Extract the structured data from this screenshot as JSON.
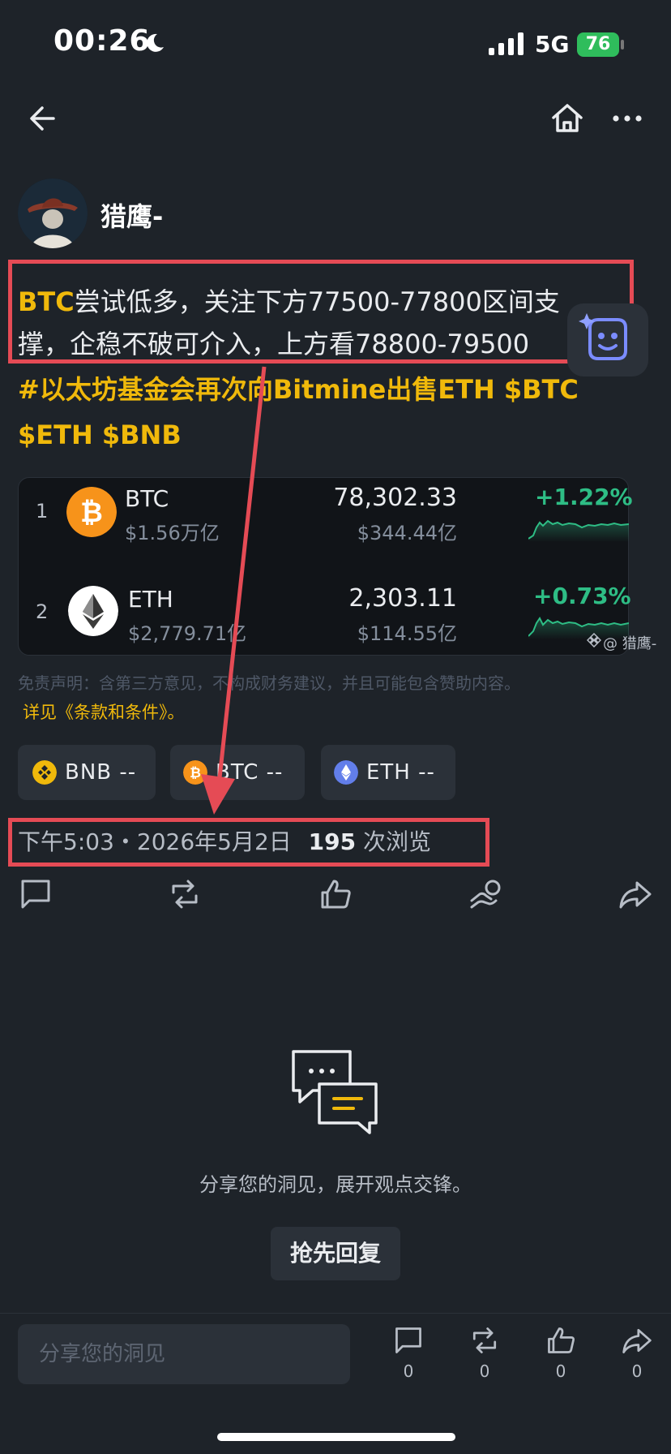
{
  "status": {
    "time": "00:26",
    "network": "5G",
    "battery": "76"
  },
  "author": {
    "name": "猎鹰-"
  },
  "post": {
    "tag": "BTC",
    "line1_rest": "尝试低多，关注下方77500-77800区间支",
    "line2": "撑，企稳不破可介入，上方看78800-79500",
    "hashtag_line": "#以太坊基金会再次向Bitmine出售ETH $BTC",
    "cashtags_line": "$ETH $BNB"
  },
  "market": {
    "rows": [
      {
        "rank": "1",
        "symbol": "BTC",
        "cap": "$1.56万亿",
        "price": "78,302.33",
        "volume": "$344.44亿",
        "change": "+1.22%"
      },
      {
        "rank": "2",
        "symbol": "ETH",
        "cap": "$2,779.71亿",
        "price": "2,303.11",
        "volume": "$114.55亿",
        "change": "+0.73%"
      }
    ],
    "watermark": "@ 猎鹰-"
  },
  "disclaimer": "免责声明：含第三方意见，不构成财务建议，并且可能包含赞助内容。",
  "terms": "详见《条款和条件》。",
  "chips": [
    {
      "label": "BNB --",
      "color": "#f0b90b"
    },
    {
      "label": "BTC --",
      "color": "#f7931a"
    },
    {
      "label": "ETH --",
      "color": "#627eea"
    }
  ],
  "meta": {
    "datetime": "下午5:03・2026年5月2日",
    "views": "195",
    "views_suffix": "次浏览"
  },
  "empty": {
    "text": "分享您的洞见，展开观点交锋。",
    "button": "抢先回复"
  },
  "bottom": {
    "placeholder": "分享您的洞见",
    "counts": {
      "comment": "0",
      "repost": "0",
      "like": "0",
      "share": "0"
    }
  },
  "colors": {
    "accent": "#f0b90b",
    "up": "#2ebd85",
    "bg": "#1e2329",
    "annotation": "#e54b55"
  }
}
